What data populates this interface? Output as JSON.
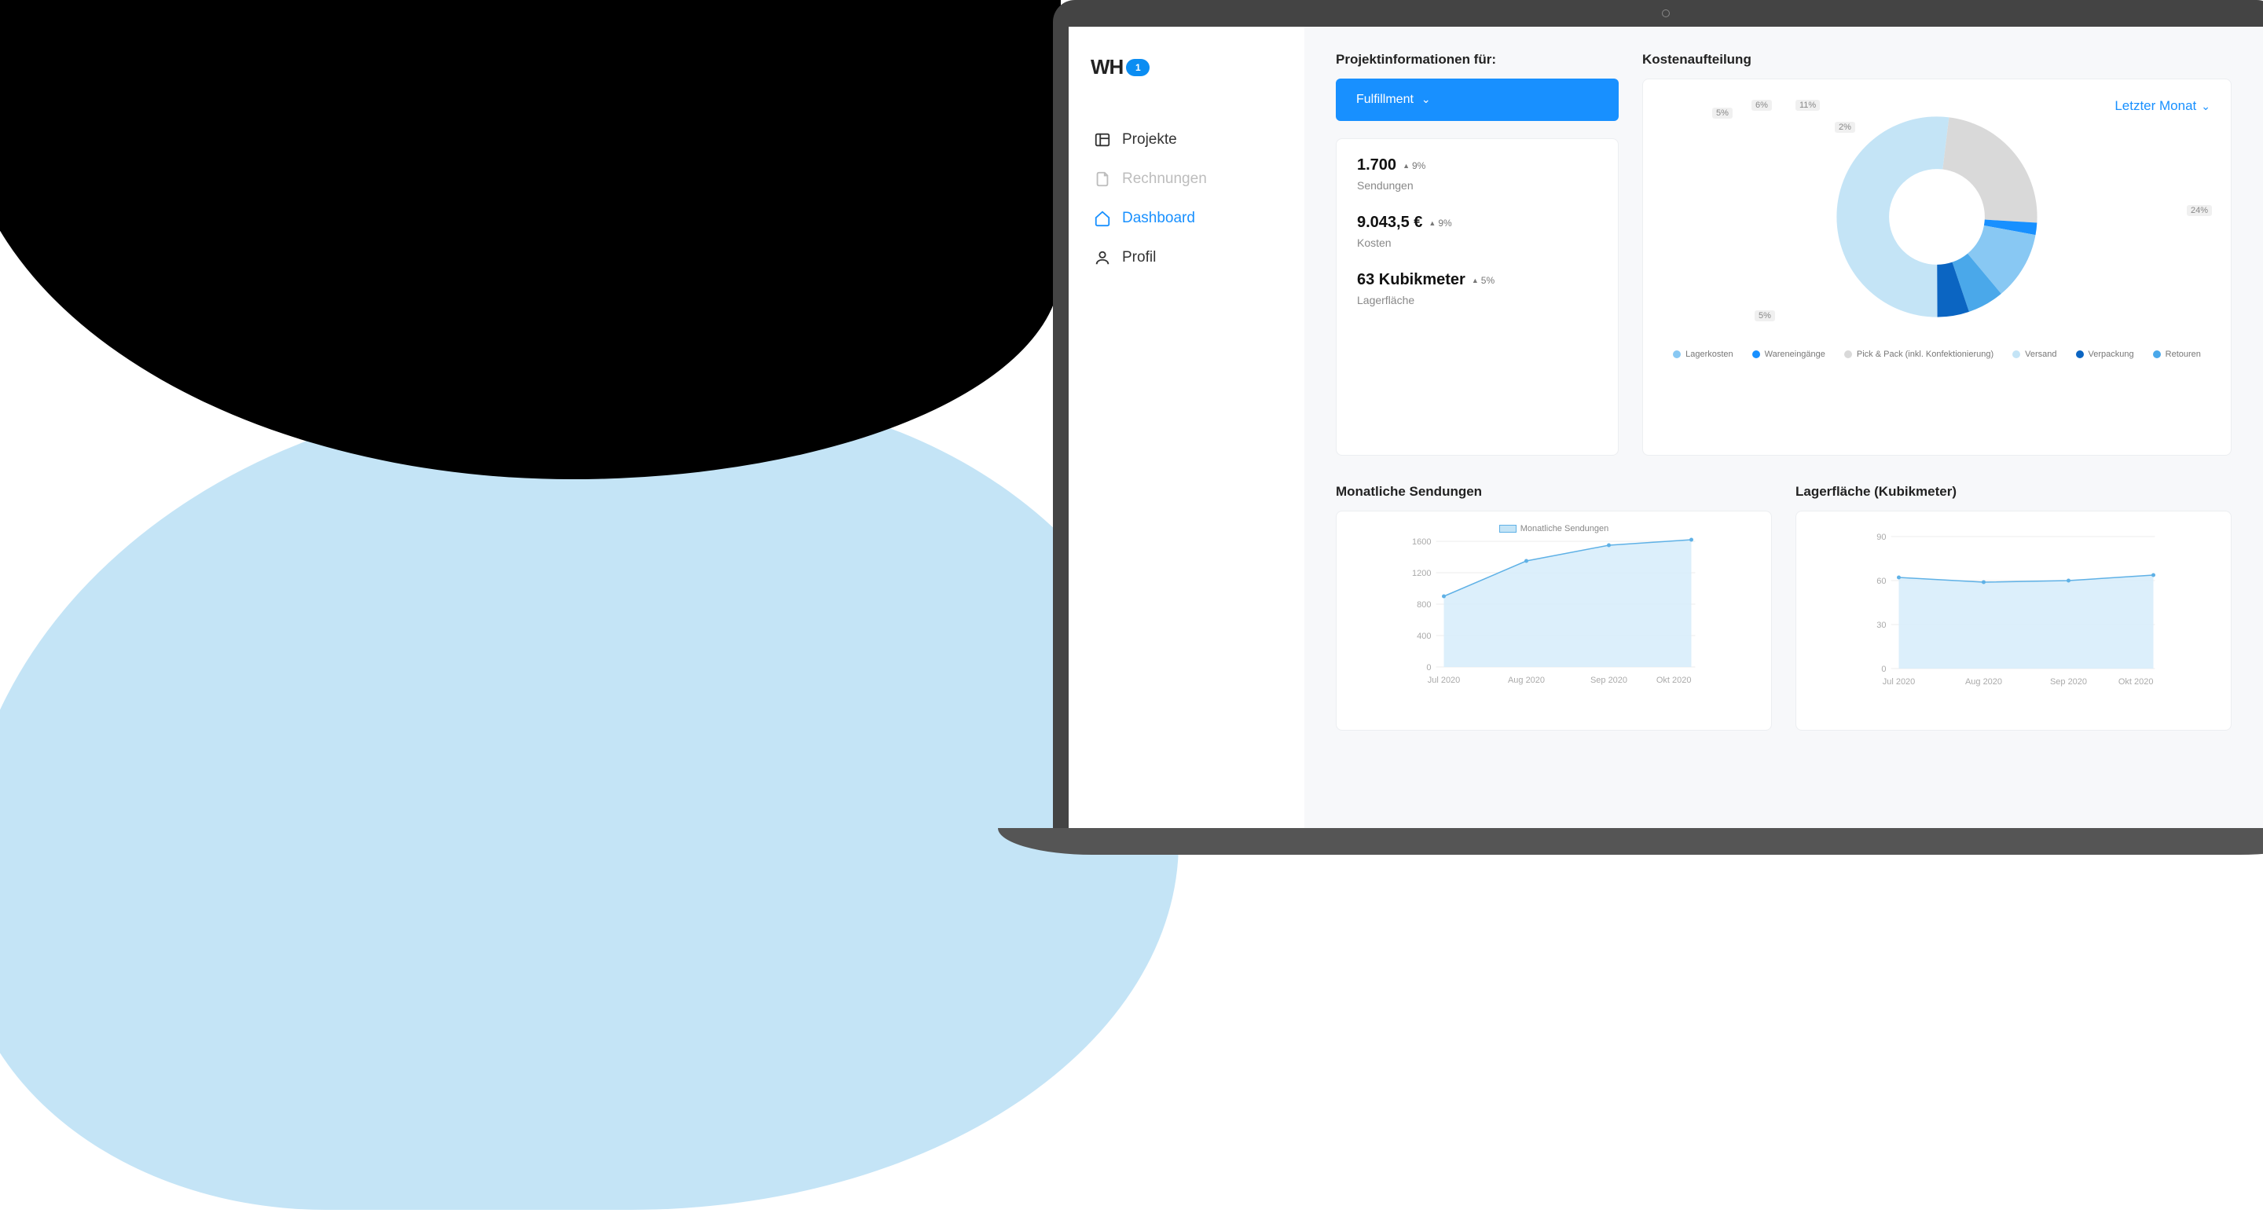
{
  "logo": {
    "text": "WH",
    "badge": "1"
  },
  "nav": {
    "projekte": "Projekte",
    "rechnungen": "Rechnungen",
    "dashboard": "Dashboard",
    "profil": "Profil"
  },
  "proj": {
    "title": "Projektinformationen für:",
    "dropdown": "Fulfillment",
    "stats": [
      {
        "value": "1.700",
        "delta": "9%",
        "label": "Sendungen"
      },
      {
        "value": "9.043,5 €",
        "delta": "9%",
        "label": "Kosten"
      },
      {
        "value": "63 Kubikmeter",
        "delta": "5%",
        "label": "Lagerfläche"
      }
    ]
  },
  "cost": {
    "title": "Kostenaufteilung",
    "period": "Letzter Monat",
    "legend": {
      "lagerkosten": "Lagerkosten",
      "wareneingaenge": "Wareneingänge",
      "pickpack": "Pick & Pack (inkl. Konfektionierung)",
      "versand": "Versand",
      "verpackung": "Verpackung",
      "retouren": "Retouren"
    }
  },
  "monthly": {
    "title": "Monatliche Sendungen",
    "legend": "Monatliche Sendungen"
  },
  "storage": {
    "title": "Lagerfläche (Kubikmeter)"
  },
  "months": {
    "jul": "Jul 2020",
    "aug": "Aug 2020",
    "sep": "Sep 2020",
    "okt": "Okt 2020"
  },
  "ytick": {
    "m0": "0",
    "m400": "400",
    "m800": "800",
    "m1200": "1200",
    "m1600": "1600",
    "s0": "0",
    "s30": "30",
    "s60": "60",
    "s90": "90"
  },
  "donut_labels": {
    "l5a": "5%",
    "l6": "6%",
    "l11": "11%",
    "l2": "2%",
    "l24": "24%",
    "l5b": "5%"
  },
  "colors": {
    "primary": "#1890ff",
    "deep": "#0b65c2",
    "mid": "#4aa8ea",
    "light": "#88c8f3",
    "vlight": "#c4e4f6",
    "grey": "#d9d9d9"
  },
  "chart_data": [
    {
      "type": "pie",
      "title": "Kostenaufteilung",
      "series": [
        {
          "name": "Lagerkosten",
          "value": 52,
          "color": "#c4e4f6"
        },
        {
          "name": "Wareneingänge",
          "value": 2,
          "color": "#1890ff"
        },
        {
          "name": "Pick & Pack (inkl. Konfektionierung)",
          "value": 24,
          "color": "#d9d9d9"
        },
        {
          "name": "Versand",
          "value": 5,
          "color": "#c4e4f6"
        },
        {
          "name": "Verpackung",
          "value": 5,
          "color": "#0b65c2"
        },
        {
          "name": "Retouren",
          "value": 6,
          "color": "#4aa8ea"
        }
      ]
    },
    {
      "type": "area",
      "title": "Monatliche Sendungen",
      "categories": [
        "Jul 2020",
        "Aug 2020",
        "Sep 2020",
        "Okt 2020"
      ],
      "values": [
        900,
        1350,
        1550,
        1620
      ],
      "ylim": [
        0,
        1600
      ],
      "xlabel": "",
      "ylabel": ""
    },
    {
      "type": "area",
      "title": "Lagerfläche (Kubikmeter)",
      "categories": [
        "Jul 2020",
        "Aug 2020",
        "Sep 2020",
        "Okt 2020"
      ],
      "values": [
        62,
        59,
        60,
        64
      ],
      "ylim": [
        0,
        90
      ],
      "xlabel": "",
      "ylabel": ""
    }
  ]
}
